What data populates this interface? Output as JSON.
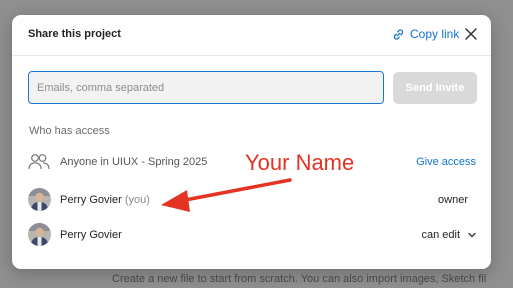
{
  "background": {
    "text": "Create a new file to start from scratch. You can also import images, Sketch fil"
  },
  "modal": {
    "title": "Share this project",
    "copy_link_label": "Copy link",
    "close_icon": "close-icon",
    "link_icon": "link-icon"
  },
  "invite": {
    "placeholder": "Emails, comma separated",
    "value": "",
    "send_label": "Send Invite"
  },
  "access": {
    "heading": "Who has access",
    "group": {
      "icon": "people-icon",
      "label": "Anyone in UIUX - Spring 2025",
      "action": "Give access"
    },
    "members": [
      {
        "name": "Perry Govier",
        "tag": "(you)",
        "role": "owner"
      },
      {
        "name": "Perry Govier",
        "tag": "",
        "role": "can edit"
      }
    ]
  },
  "annotation": {
    "text": "Your Name",
    "color": "#e53323"
  },
  "colors": {
    "accent": "#1273d1",
    "input_border": "#1a74d4",
    "send_disabled": "#d9d9d9"
  }
}
